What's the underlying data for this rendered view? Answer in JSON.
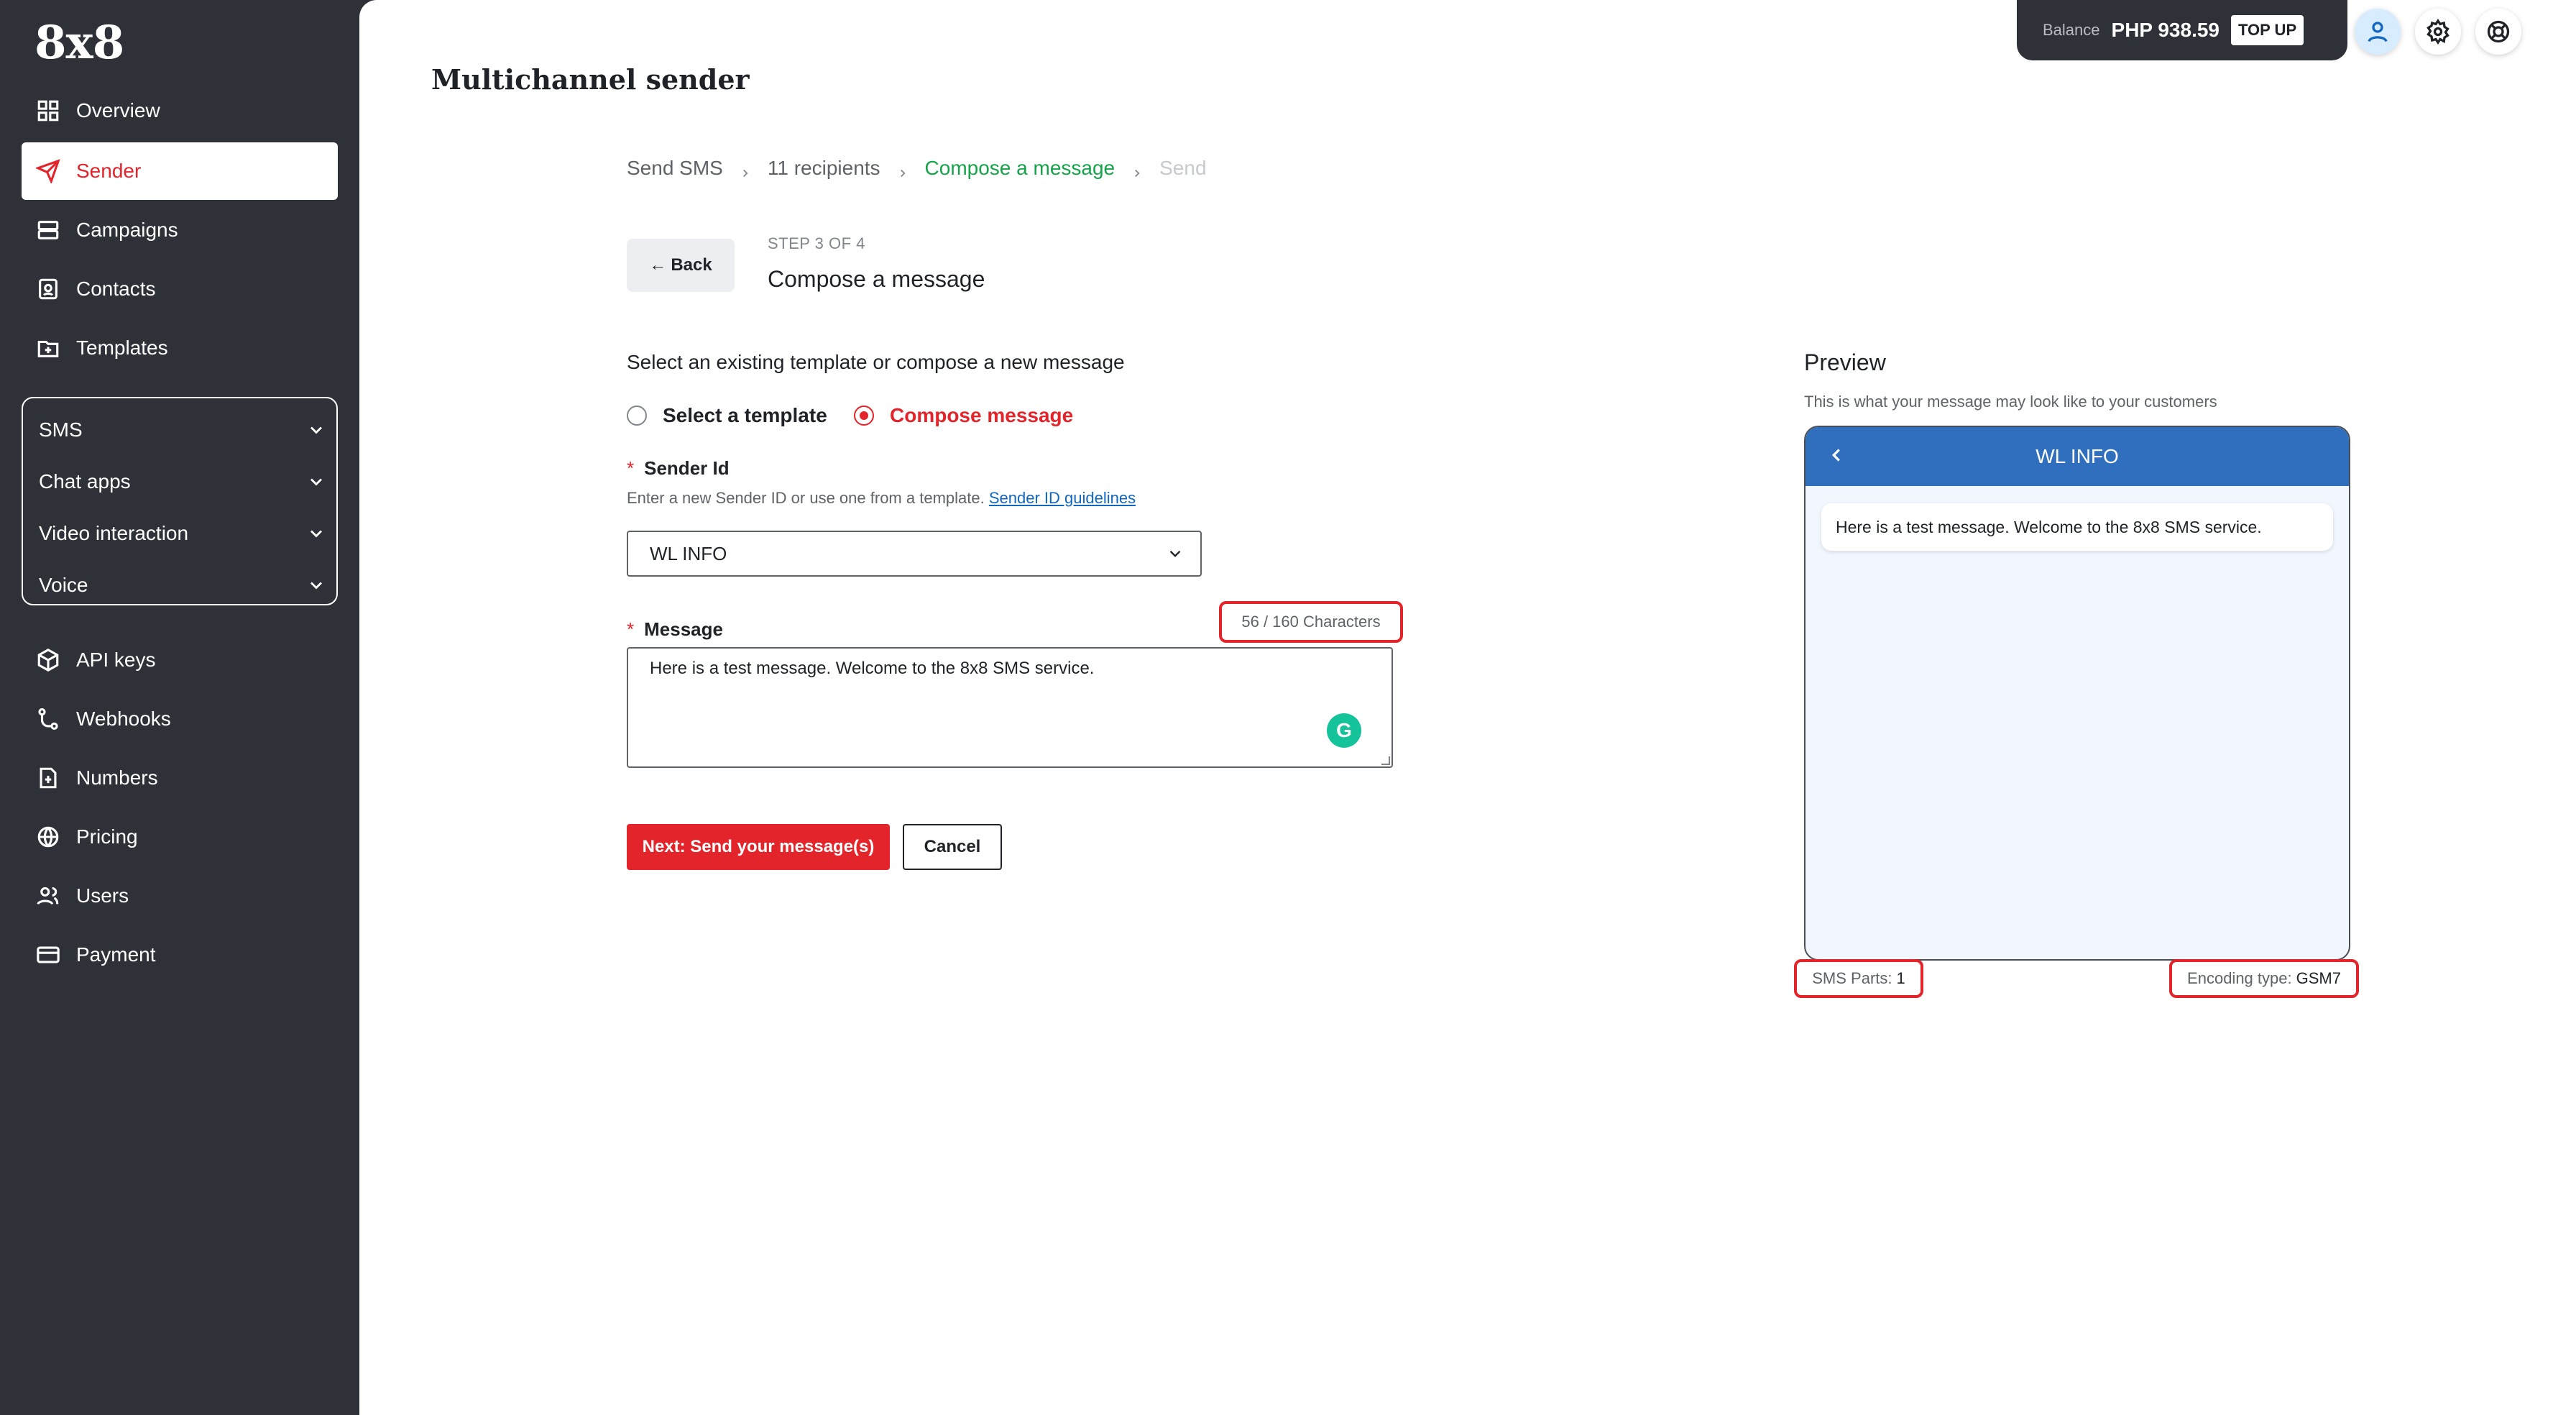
{
  "brand": {
    "logo": "8x8"
  },
  "sidebar": {
    "items": [
      {
        "label": "Overview",
        "icon": "grid-icon"
      },
      {
        "label": "Sender",
        "icon": "send-icon",
        "active": true
      },
      {
        "label": "Campaigns",
        "icon": "campaigns-icon"
      },
      {
        "label": "Contacts",
        "icon": "contacts-icon"
      },
      {
        "label": "Templates",
        "icon": "templates-icon"
      }
    ],
    "groups": [
      {
        "label": "SMS"
      },
      {
        "label": "Chat apps"
      },
      {
        "label": "Video interaction"
      },
      {
        "label": "Voice"
      }
    ],
    "bottom_items": [
      {
        "label": "API keys",
        "icon": "cube-icon"
      },
      {
        "label": "Webhooks",
        "icon": "webhook-icon"
      },
      {
        "label": "Numbers",
        "icon": "numbers-icon"
      },
      {
        "label": "Pricing",
        "icon": "globe-icon"
      },
      {
        "label": "Users",
        "icon": "users-icon"
      },
      {
        "label": "Payment",
        "icon": "card-icon"
      }
    ]
  },
  "header": {
    "title": "Multichannel sender",
    "balance_label": "Balance",
    "balance_value": "PHP 938.59",
    "topup_label": "TOP UP"
  },
  "breadcrumb": [
    "Send SMS",
    "11 recipients",
    "Compose a message",
    "Send"
  ],
  "step": {
    "back_label": "Back",
    "label": "STEP 3 OF 4",
    "title": "Compose a message"
  },
  "form": {
    "intro": "Select an existing template or compose a new message",
    "radio_template": "Select a template",
    "radio_compose": "Compose message",
    "sender_label": "Sender Id",
    "sender_helper": "Enter a new Sender ID or use one from a template.",
    "sender_link": "Sender ID guidelines",
    "sender_value": "WL INFO",
    "message_label": "Message",
    "char_count": "56 / 160 Characters",
    "message_value": "Here is a test message. Welcome to the 8x8 SMS service.",
    "next_label": "Next: Send your message(s)",
    "cancel_label": "Cancel"
  },
  "preview": {
    "title": "Preview",
    "subtitle": "This is what your message may look like to your customers",
    "header": "WL INFO",
    "bubble": "Here is a test message. Welcome to the 8x8 SMS service.",
    "sms_parts_label": "SMS Parts:",
    "sms_parts_value": "1",
    "encoding_label": "Encoding type:",
    "encoding_value": "GSM7"
  },
  "colors": {
    "accent": "#e3242b",
    "sidebar": "#2e3138",
    "preview_header": "#2f6fbd",
    "breadcrumb_current": "#17a34a"
  }
}
